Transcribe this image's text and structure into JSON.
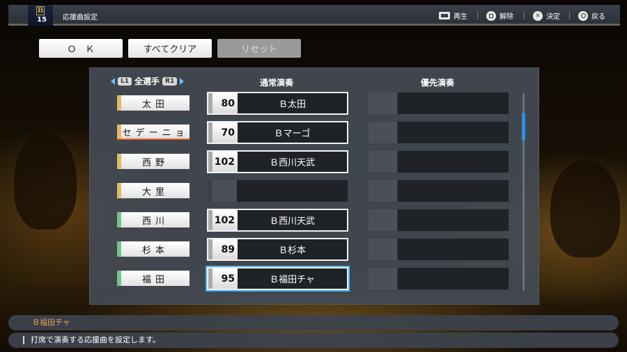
{
  "header": {
    "logo_letter": "B",
    "logo_number": "15",
    "title": "応援曲設定",
    "hints": [
      {
        "icon": "touchpad-icon",
        "label": "再生"
      },
      {
        "icon": "square-button-icon",
        "label": "解除"
      },
      {
        "icon": "cross-button-icon",
        "label": "決定"
      },
      {
        "icon": "circle-button-icon",
        "label": "戻る"
      }
    ]
  },
  "buttons": {
    "ok": "Ｏ　Ｋ",
    "clear_all": "すべてクリア",
    "reset": "リセット"
  },
  "filter": {
    "l1": "L1",
    "label": "全選手",
    "r1": "R1"
  },
  "columns": {
    "normal": "通常演奏",
    "priority": "優先演奏"
  },
  "players": [
    {
      "name": "太田",
      "stripe": "#e2b968",
      "num": "80",
      "song": "Ｂ太田"
    },
    {
      "name": "セデーニョ",
      "stripe": "#e2b968",
      "num": "70",
      "song": "Ｂマーゴ"
    },
    {
      "name": "西野",
      "stripe": "#e2b968",
      "num": "102",
      "song": "Ｂ西川天武"
    },
    {
      "name": "大里",
      "stripe": "#e2b968",
      "num": "",
      "song": ""
    },
    {
      "name": "西川",
      "stripe": "#74c48a",
      "num": "102",
      "song": "Ｂ西川天武"
    },
    {
      "name": "杉本",
      "stripe": "#74c48a",
      "num": "89",
      "song": "Ｂ杉本"
    },
    {
      "name": "福田",
      "stripe": "#74c48a",
      "num": "95",
      "song": "Ｂ福田チャ"
    }
  ],
  "info": {
    "song_name": "Ｂ福田チャ",
    "description": "打席で演奏する応援曲を設定します。"
  }
}
